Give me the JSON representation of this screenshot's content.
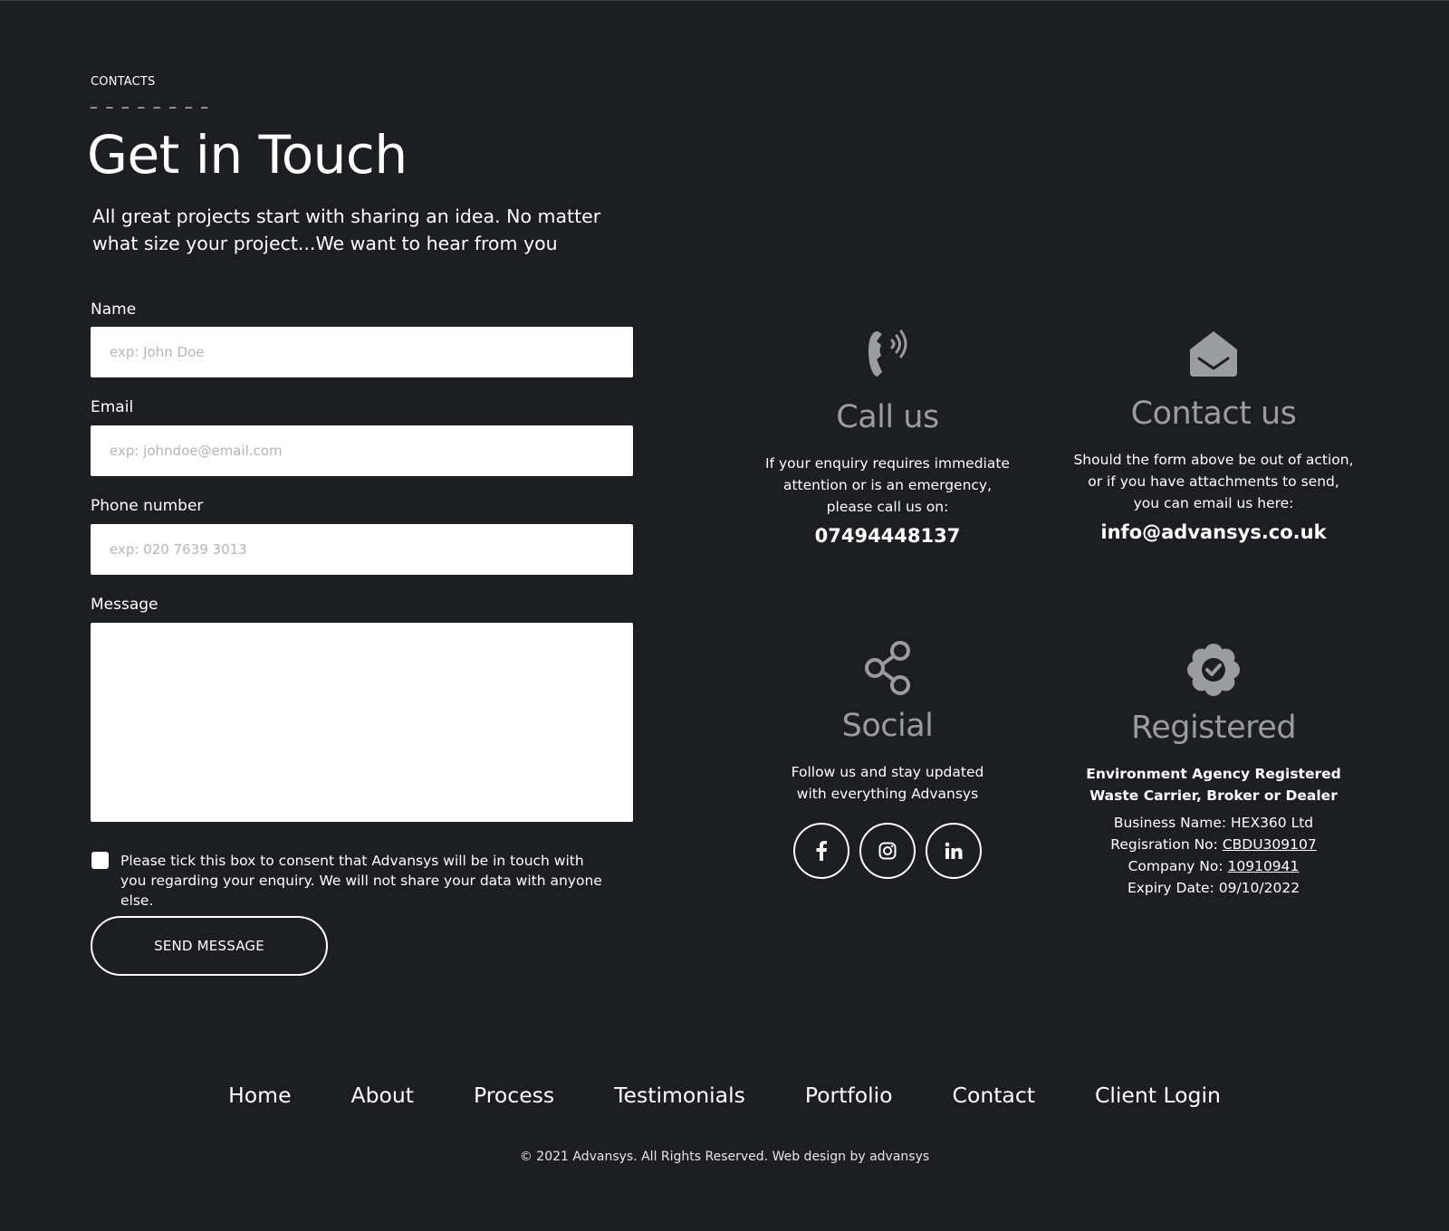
{
  "header": {
    "eyebrow": "CONTACTS",
    "dashes": "_ _ _ _ _ _ _ _",
    "title": "Get in Touch",
    "intro": "All great projects start with sharing an idea. No matter what size your project...We want to hear from you"
  },
  "form": {
    "name_label": "Name",
    "name_placeholder": "exp: John Doe",
    "email_label": "Email",
    "email_placeholder": "exp: johndoe@email.com",
    "phone_label": "Phone number",
    "phone_placeholder": "exp: 020 7639 3013",
    "message_label": "Message",
    "message_value": "",
    "consent_checked": false,
    "consent_text": "Please tick this box to consent that Advansys will be in touch with you regarding your enquiry. We will not share your data with anyone else.",
    "send_label": "SEND MESSAGE"
  },
  "info": {
    "call": {
      "icon": "phone-icon",
      "title": "Call us",
      "desc_line1": "If your enquiry requires immediate",
      "desc_line2": "attention or is an emergency,",
      "desc_line3": "please call us on:",
      "phone": "07494448137"
    },
    "contact": {
      "icon": "envelope-open-icon",
      "title": "Contact us",
      "desc_line1": "Should the form above be out of action,",
      "desc_line2": "or if you have attachments to send,",
      "desc_line3": "you can email us here:",
      "email": "info@advansys.co.uk"
    },
    "social": {
      "icon": "share-icon",
      "title": "Social",
      "desc_line1": "Follow us and stay updated",
      "desc_line2": "with everything Advansys",
      "links": [
        "facebook-icon",
        "instagram-icon",
        "linkedin-icon"
      ]
    },
    "registered": {
      "icon": "verified-badge-icon",
      "title": "Registered",
      "bold_line1": "Environment Agency Registered",
      "bold_line2": "Waste Carrier, Broker or Dealer",
      "business_label": "Business Name: HEX360 Ltd",
      "registration_label": "Regisration No: ",
      "registration_no": "CBDU309107",
      "company_label": "Company No: ",
      "company_no": "10910941",
      "expiry_label": "Expiry Date: 09/10/2022"
    }
  },
  "footer": {
    "nav": [
      "Home",
      "About",
      "Process",
      "Testimonials",
      "Portfolio",
      "Contact",
      "Client Login"
    ],
    "copyright": "© 2021 Advansys. All Rights Reserved. Web design by advansys"
  },
  "colors": {
    "background": "#1d1e22",
    "muted_icon": "#9b9ca0",
    "text": "#ffffff"
  }
}
